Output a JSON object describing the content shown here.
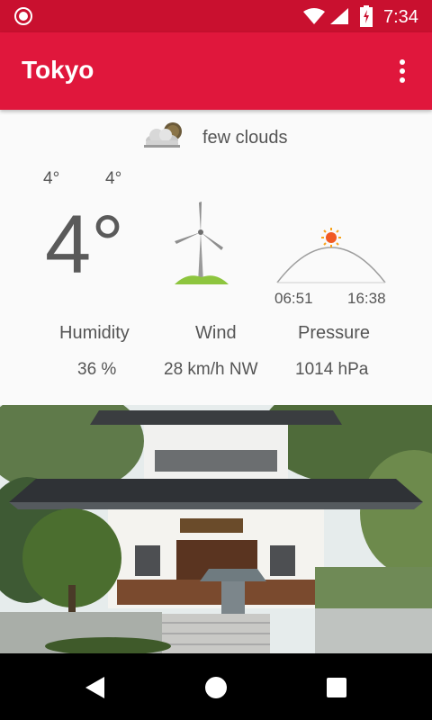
{
  "status_bar": {
    "time": "7:34",
    "icons": [
      "record-icon",
      "wifi-icon",
      "signal-icon",
      "battery-charging-icon"
    ],
    "color": "#c9102f"
  },
  "app_bar": {
    "title": "Tokyo",
    "menu_icon": "more-vert-icon",
    "color": "#e0173c"
  },
  "weather": {
    "condition": "few clouds",
    "condition_icon": "few-clouds-icon",
    "temp_min": "4°",
    "temp_max": "4°",
    "temperature": "4°",
    "sunrise": "06:51",
    "sunset": "16:38",
    "wind_icon": "windmill-icon",
    "sun_icon": "sun-arc-icon",
    "details": [
      {
        "label": "Humidity",
        "value": "36 %"
      },
      {
        "label": "Wind",
        "value": "28 km/h NW"
      },
      {
        "label": "Pressure",
        "value": "1014 hPa"
      }
    ]
  },
  "photo": {
    "subject": "temple-photo"
  },
  "nav_bar": {
    "icons": [
      "back-icon",
      "home-icon",
      "recents-icon"
    ]
  }
}
